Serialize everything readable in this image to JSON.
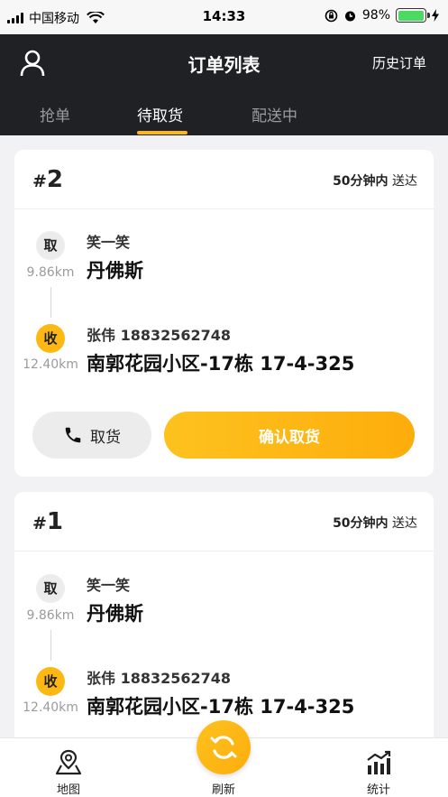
{
  "status_bar": {
    "carrier": "中国移动",
    "time": "14:33",
    "battery": "98%"
  },
  "header": {
    "title": "订单列表",
    "history": "历史订单"
  },
  "tabs": [
    {
      "label": "抢单"
    },
    {
      "label": "待取货"
    },
    {
      "label": "配送中"
    }
  ],
  "active_tab": "待取货",
  "orders": [
    {
      "hash": "#",
      "number": "2",
      "deliver_time": "50分钟内",
      "deliver_suffix": "送达",
      "pickup_badge": "取",
      "pickup_distance": "9.86km",
      "pickup_name": "笑一笑",
      "pickup_address": "丹佛斯",
      "receive_badge": "收",
      "receive_distance": "12.40km",
      "receive_contact": "张伟 18832562748",
      "receive_address": "南郭花园小区-17栋 17-4-325",
      "call_label": "取货",
      "confirm_label": "确认取货"
    },
    {
      "hash": "#",
      "number": "1",
      "deliver_time": "50分钟内",
      "deliver_suffix": "送达",
      "pickup_badge": "取",
      "pickup_distance": "9.86km",
      "pickup_name": "笑一笑",
      "pickup_address": "丹佛斯",
      "receive_badge": "收",
      "receive_distance": "12.40km",
      "receive_contact": "张伟 18832562748",
      "receive_address": "南郭花园小区-17栋 17-4-325"
    }
  ],
  "bottom_nav": {
    "map": "地图",
    "refresh": "刷新",
    "stats": "统计"
  },
  "colors": {
    "accent": "#fdb813",
    "header_bg": "#202124"
  }
}
